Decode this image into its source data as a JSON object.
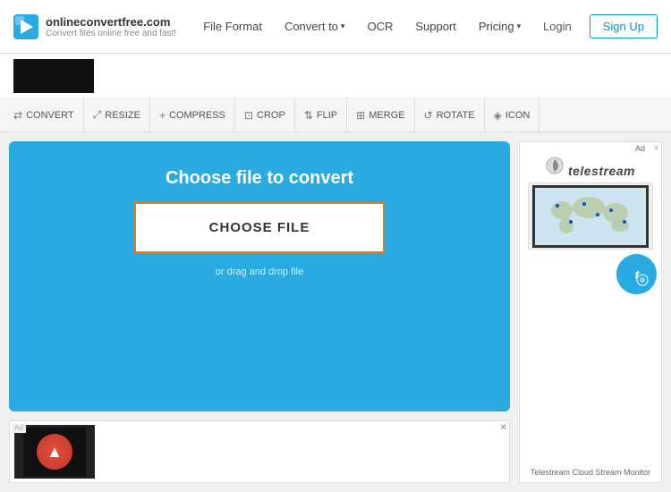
{
  "header": {
    "logo_title": "onlineconvertfree.com",
    "logo_subtitle": "Convert files online free and fast!",
    "nav": [
      {
        "label": "File Format",
        "has_arrow": false
      },
      {
        "label": "Convert to",
        "has_arrow": true
      },
      {
        "label": "OCR",
        "has_arrow": false
      },
      {
        "label": "Support",
        "has_arrow": false
      },
      {
        "label": "Pricing",
        "has_arrow": true
      }
    ],
    "login_label": "Login",
    "signup_label": "Sign Up"
  },
  "toolbar": {
    "items": [
      {
        "label": "CONVERT",
        "icon": "⇄"
      },
      {
        "label": "RESIZE",
        "icon": "⤢"
      },
      {
        "label": "COMPRESS",
        "icon": "+"
      },
      {
        "label": "CROP",
        "icon": "⊡"
      },
      {
        "label": "FLIP",
        "icon": "⇅"
      },
      {
        "label": "MERGE",
        "icon": "⊞"
      },
      {
        "label": "ROTATE",
        "icon": "↺"
      },
      {
        "label": "ICON",
        "icon": "◈"
      }
    ]
  },
  "main": {
    "convert_box": {
      "title": "Choose file to convert",
      "choose_btn": "CHOOSE FILE",
      "drag_text": "or drag and drop file"
    }
  },
  "right_ad": {
    "brand": "telestream",
    "footer": "Telestream Cloud Stream Monitor"
  }
}
